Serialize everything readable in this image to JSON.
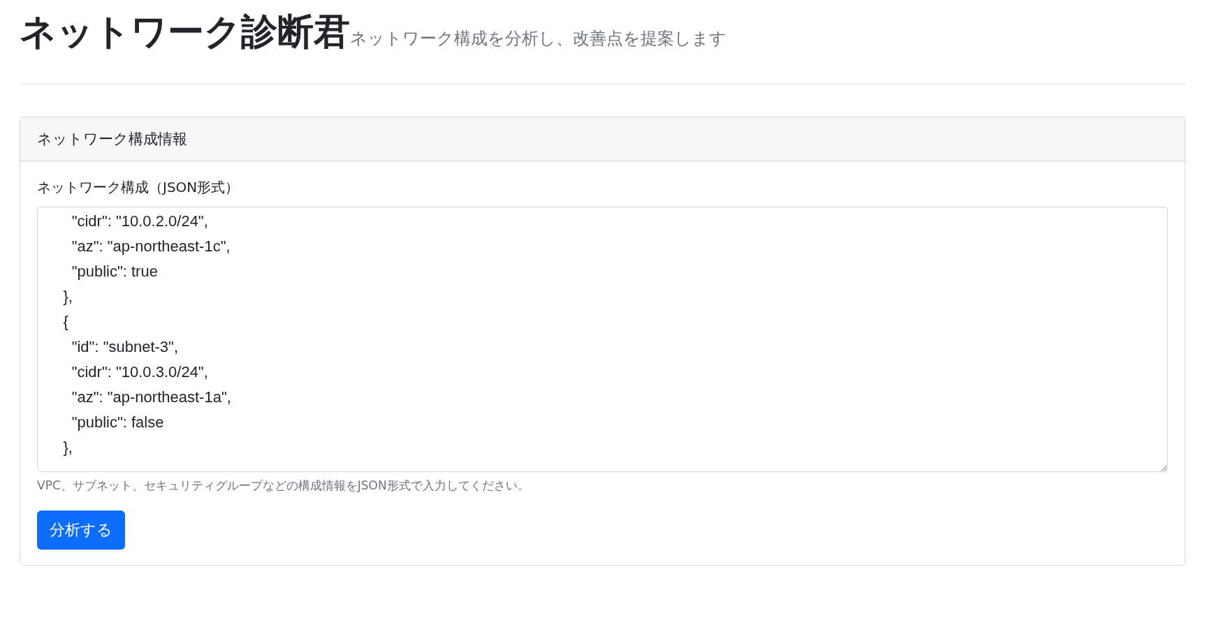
{
  "header": {
    "title": "ネットワーク診断君",
    "subtitle": "ネットワーク構成を分析し、改善点を提案します"
  },
  "card": {
    "title": "ネットワーク構成情報",
    "field": {
      "label": "ネットワーク構成（JSON形式）",
      "value": "      \"cidr\": \"10.0.2.0/24\",\n      \"az\": \"ap-northeast-1c\",\n      \"public\": true\n    },\n    {\n      \"id\": \"subnet-3\",\n      \"cidr\": \"10.0.3.0/24\",\n      \"az\": \"ap-northeast-1a\",\n      \"public\": false\n    },",
      "help": "VPC、サブネット、セキュリティグループなどの構成情報をJSON形式で入力してください。"
    },
    "button": "分析する"
  }
}
